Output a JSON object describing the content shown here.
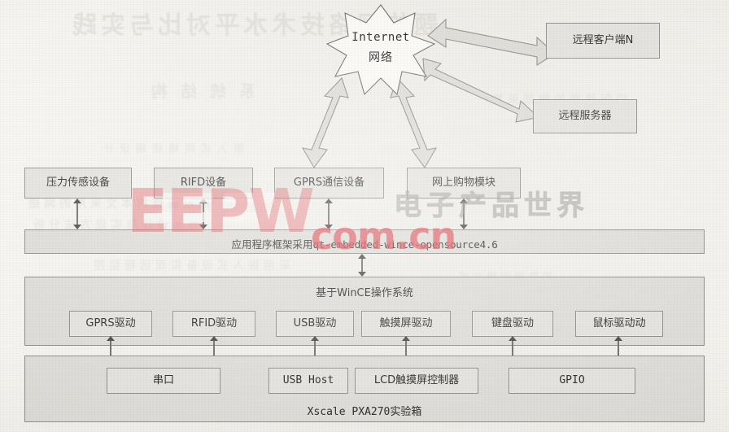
{
  "figure": {
    "kind": "system-architecture-diagram",
    "internet_cloud": {
      "line1": "Internet",
      "line2": "网络"
    },
    "external_nodes": [
      {
        "id": "remote-client",
        "label": "远程客户端N"
      },
      {
        "id": "remote-server",
        "label": "远程服务器"
      }
    ],
    "device_layer": [
      {
        "id": "pressure-sensor",
        "label": "压力传感设备"
      },
      {
        "id": "rifd-device",
        "label": "RIFD设备"
      },
      {
        "id": "gprs-comm-device",
        "label": "GPRS通信设备"
      },
      {
        "id": "online-shopping-module",
        "label": "网上购物模块"
      }
    ],
    "framework_layer": {
      "id": "application-framework",
      "label_zh": "应用程序框架采用",
      "label_mono": "qt-embedded-wince-opensource4.6",
      "label_full": "应用程序框架采用qt-embedded-wince-opensource4.6"
    },
    "os_layer": {
      "id": "wince-os",
      "label": "基于WinCE操作系统",
      "drivers": [
        {
          "id": "gprs-driver",
          "label": "GPRS驱动"
        },
        {
          "id": "rfid-driver",
          "label": "RFID驱动"
        },
        {
          "id": "usb-driver",
          "label": "USB驱动"
        },
        {
          "id": "touchscreen-driver",
          "label": "触摸屏驱动"
        },
        {
          "id": "keyboard-driver",
          "label": "键盘驱动"
        },
        {
          "id": "mouse-driver",
          "label": "鼠标驱动动"
        }
      ]
    },
    "hardware_layer": {
      "id": "xscale-pxa270",
      "label": "Xscale PXA270实验箱",
      "interfaces": [
        {
          "id": "serial-port",
          "label": "串口"
        },
        {
          "id": "usb-host",
          "label": "USB Host"
        },
        {
          "id": "lcd-touch-controller",
          "label": "LCD触摸屏控制器"
        },
        {
          "id": "gpio",
          "label": "GPIO"
        }
      ]
    }
  },
  "watermark": {
    "brand": "EEPW",
    "domain": "com.cn",
    "chinese": "电子产品世界",
    "color": "#e0424a",
    "chinese_color": "#a8a49c"
  },
  "bleed_through": {
    "note": "faint mirrored show-through text from the reverse side of the scanned page",
    "line_title": "题的网络技术水平对比与实践",
    "line_sub": "系统结构",
    "line_a": "的系统结构本文采用的网络",
    "line_b": "方案设计与实现方法分析",
    "line_c": "嵌入式网络终端设计",
    "line_d": "采用嵌入式设备实现远程监控",
    "line_e": "的数据传输方式",
    "line_f": "控制终端的数据采集"
  },
  "colors": {
    "paper": "#f4f2ee",
    "box_fill": "#e3e2de",
    "band_fill": "#dedcd8",
    "box_stroke": "#8e8c88",
    "arrow_fill": "#dddbd6",
    "arrow_stroke": "#8d8b86",
    "text": "#2b2b2b"
  }
}
